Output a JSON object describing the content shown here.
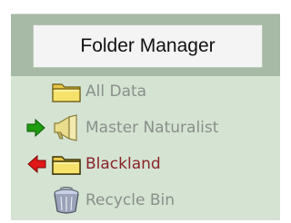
{
  "panel": {
    "title": "Folder Manager"
  },
  "folders": [
    {
      "label": "All Data",
      "icon": "folder-icon",
      "marker": ""
    },
    {
      "label": "Master Naturalist",
      "icon": "megaphone-icon",
      "marker": "green-arrow-icon"
    },
    {
      "label": "Blackland",
      "icon": "folder-icon",
      "marker": "red-arrow-icon"
    },
    {
      "label": "Recycle Bin",
      "icon": "trash-can-icon",
      "marker": ""
    }
  ],
  "colors": {
    "panel_bg": "#d4e3d2",
    "header_band": "#a6baa6",
    "muted_text": "#8a8f8a",
    "active_text": "#8a2228",
    "green_arrow": "#1f9c12",
    "red_arrow": "#e01818",
    "folder_yellow": "#f6e26a"
  }
}
